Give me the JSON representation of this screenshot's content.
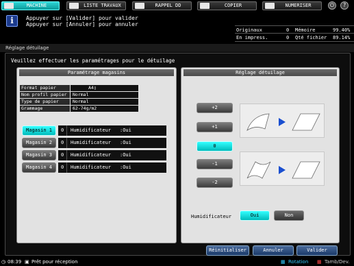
{
  "tabs": [
    {
      "label": "MACHINE",
      "icon": "machine-icon",
      "active": true
    },
    {
      "label": "LISTE TRAVAUX",
      "icon": "job-list-icon",
      "active": false
    },
    {
      "label": "RAPPEL DD",
      "icon": "hdd-recall-icon",
      "active": false
    },
    {
      "label": "COPIER",
      "icon": "copier-icon",
      "active": false
    },
    {
      "label": "NUMERISER",
      "icon": "scan-icon",
      "active": false
    }
  ],
  "top_icons": {
    "power": "⏻",
    "help": "?"
  },
  "message": {
    "line1": "Appuyer sur [Valider] pour valider",
    "line2": "Appuyer sur [Annuler] pour annuler"
  },
  "counters": {
    "originaux_label": "Originaux",
    "originaux_value": "0",
    "memoire_label": "Mémoire",
    "memoire_value": "99.40%",
    "impress_label": "En impress.",
    "impress_value": "0",
    "fichier_label": "Qté fichier",
    "fichier_value": "89.14%"
  },
  "window_title": "Réglage détuilage",
  "instruction": "Veuillez effectuer les paramétrages pour le détuilage",
  "left_panel": {
    "title": "Paramétrage magasins",
    "info": [
      {
        "label": "Format papier",
        "value": "A4▯"
      },
      {
        "label": "Nom profil papier",
        "value": "Normal"
      },
      {
        "label": "Type de papier",
        "value": "Normal"
      },
      {
        "label": "Grammage",
        "value": "62-74g/m2"
      }
    ],
    "magasins": [
      {
        "label": "Magasin 1",
        "num": "0",
        "hum": "Humidificateur",
        "val": ":Oui",
        "selected": true
      },
      {
        "label": "Magasin 2",
        "num": "0",
        "hum": "Humidificateur",
        "val": ":Oui",
        "selected": false
      },
      {
        "label": "Magasin 3",
        "num": "0",
        "hum": "Humidificateur",
        "val": ":Oui",
        "selected": false
      },
      {
        "label": "Magasin 4",
        "num": "0",
        "hum": "Humidificateur",
        "val": ":Oui",
        "selected": false
      }
    ]
  },
  "right_panel": {
    "title": "Réglage détuilage",
    "levels": [
      "+2",
      "+1",
      "0",
      "-1",
      "-2"
    ],
    "selected_level": "0",
    "humidificateur_label": "Humidificateur",
    "oui_label": "Oui",
    "non_label": "Non"
  },
  "actions": {
    "reset": "Réinitialiser",
    "cancel": "Annuler",
    "ok": "Valider"
  },
  "status": {
    "time": "08:39",
    "ready": "Prêt pour réception",
    "rotation": "Rotation",
    "tamb": "Tamb/Dev."
  },
  "colors": {
    "accent": "#22cccc",
    "action": "#2a4a7a"
  }
}
